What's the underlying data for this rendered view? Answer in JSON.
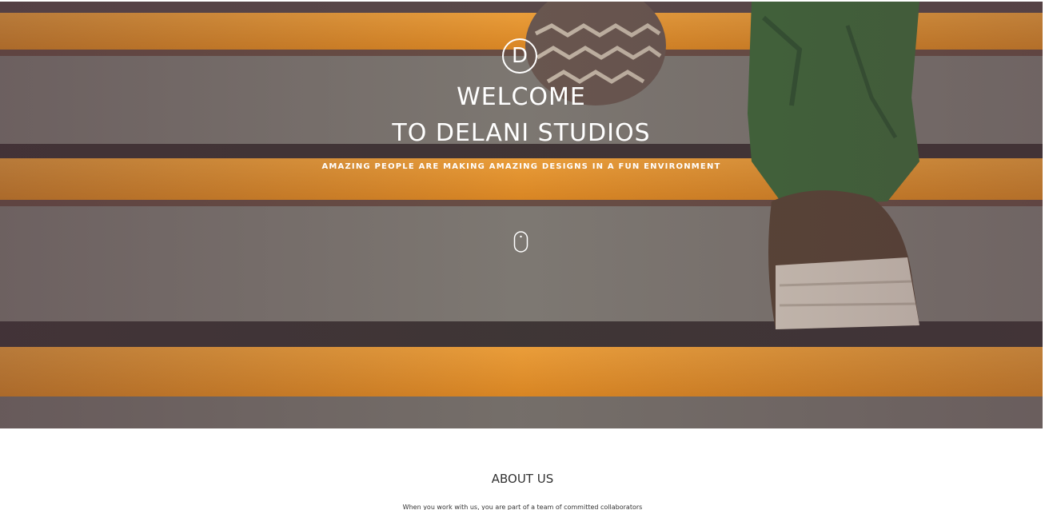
{
  "hero": {
    "logo_letter": "D",
    "title_line1": "WELCOME",
    "title_line2": "TO DELANI STUDIOS",
    "tagline": "AMAZING PEOPLE ARE MAKING AMAZING DESIGNS IN A FUN ENVIRONMENT",
    "scroll_icon": "mouse-scroll-icon"
  },
  "about": {
    "title": "ABOUT US",
    "text": "When you work with us, you are part of a team of committed collaborators"
  },
  "colors": {
    "stair_orange": "#e8962a",
    "stair_gray": "#7a7670",
    "pants_green": "#3f6a3a",
    "shoe_brown": "#5a4636",
    "text_dark": "#333333",
    "white": "#ffffff"
  }
}
